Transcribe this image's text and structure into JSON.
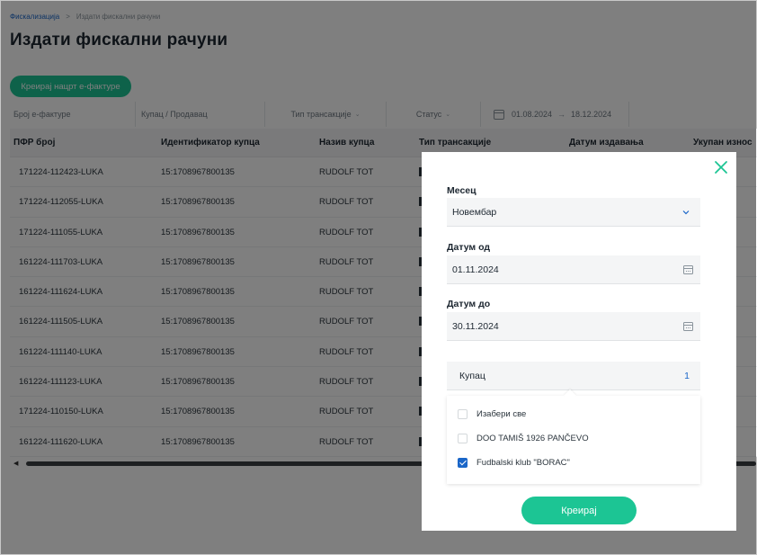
{
  "breadcrumb": {
    "link": "Фискализација",
    "separator": ">",
    "current": "Издати фискални рачуни"
  },
  "page_title": "Издати фискални рачуни",
  "create_draft_button": "Креирај нацрт е-фактуре",
  "filters": {
    "invoice_number_placeholder": "Број е-фактуре",
    "buyer_seller_placeholder": "Купац / Продавац",
    "transaction_type": "Тип трансакције",
    "status": "Статус",
    "date_from": "01.08.2024",
    "date_arrow": "→",
    "date_to": "18.12.2024"
  },
  "table": {
    "columns": [
      "ПФР број",
      "Идентификатор купца",
      "Назив купца",
      "Тип трансакције",
      "Датум издавања",
      "Укупан износ"
    ],
    "rows": [
      [
        "171224-112423-LUKA",
        "15:1708967800135",
        "RUDOLF TOT"
      ],
      [
        "171224-112055-LUKA",
        "15:1708967800135",
        "RUDOLF TOT"
      ],
      [
        "171224-111055-LUKA",
        "15:1708967800135",
        "RUDOLF TOT"
      ],
      [
        "161224-111703-LUKA",
        "15:1708967800135",
        "RUDOLF TOT"
      ],
      [
        "161224-111624-LUKA",
        "15:1708967800135",
        "RUDOLF TOT"
      ],
      [
        "161224-111505-LUKA",
        "15:1708967800135",
        "RUDOLF TOT"
      ],
      [
        "161224-111140-LUKA",
        "15:1708967800135",
        "RUDOLF TOT"
      ],
      [
        "161224-111123-LUKA",
        "15:1708967800135",
        "RUDOLF TOT"
      ],
      [
        "171224-110150-LUKA",
        "15:1708967800135",
        "RUDOLF TOT"
      ],
      [
        "161224-111620-LUKA",
        "15:1708967800135",
        "RUDOLF TOT"
      ]
    ]
  },
  "modal": {
    "month_label": "Месец",
    "month_value": "Новембар",
    "date_from_label": "Датум од",
    "date_from_value": "01.11.2024",
    "date_to_label": "Датум до",
    "date_to_value": "30.11.2024",
    "buyer_label": "Купац",
    "buyer_selected_count": "1",
    "buyer_options": [
      {
        "label": "Изабери све",
        "checked": false
      },
      {
        "label": "DOO TAMIŠ 1926 PANČEVO",
        "checked": false
      },
      {
        "label": "Fudbalski klub \"BORAC\"",
        "checked": true
      }
    ],
    "create_button": "Креирај"
  },
  "colors": {
    "accent_green": "#1cc594",
    "link_blue": "#1a66c8",
    "close_icon": "#1cc594"
  }
}
